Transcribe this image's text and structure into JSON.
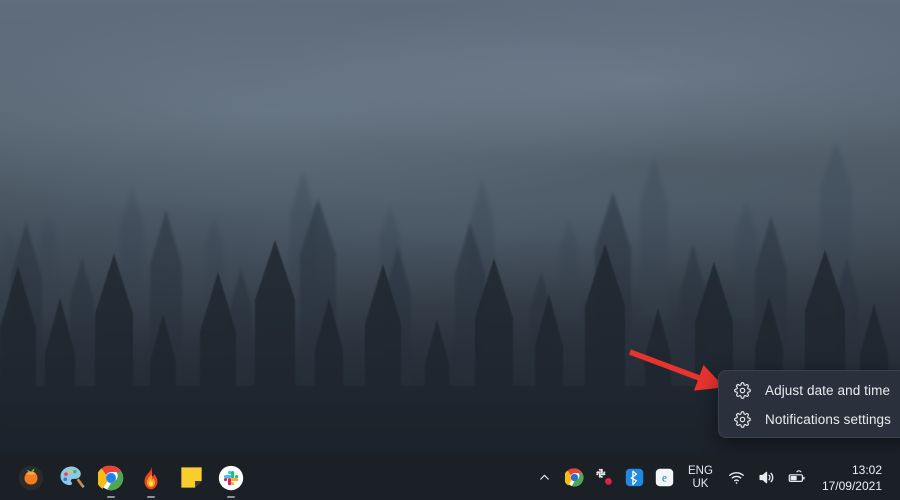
{
  "desktop": {
    "wallpaper_description": "misty-forest-conifers",
    "colors": {
      "sky": "#5f6d7d",
      "fog": "#8c9eb2",
      "tree_dark": "#232a33",
      "taskbar": "#1b2027",
      "menu_background": "#2a313c",
      "menu_text": "#e9ecef",
      "annotation_arrow": "#e8332f"
    }
  },
  "annotation": {
    "type": "arrow",
    "color": "#e8332f",
    "points_to": "adjust-date-and-time-menu-item"
  },
  "context_menu": {
    "items": [
      {
        "label": "Adjust date and time",
        "icon": "gear-icon"
      },
      {
        "label": "Notifications settings",
        "icon": "gear-icon"
      }
    ]
  },
  "taskbar": {
    "apps": [
      {
        "name": "fl-studio",
        "label": "FL Studio",
        "running": false
      },
      {
        "name": "paint",
        "label": "Paint",
        "running": false
      },
      {
        "name": "chrome",
        "label": "Google Chrome",
        "running": true
      },
      {
        "name": "flame-app",
        "label": "Flame",
        "running": true
      },
      {
        "name": "sticky-notes",
        "label": "Sticky Notes",
        "running": false
      },
      {
        "name": "slack",
        "label": "Slack",
        "running": true
      }
    ],
    "tray": {
      "show_hidden_icons": "chevron-up-icon",
      "icons": [
        {
          "name": "chrome-tray-icon",
          "label": "Google Chrome"
        },
        {
          "name": "slack-tray-icon",
          "label": "Slack"
        },
        {
          "name": "bluetooth-icon",
          "label": "Bluetooth"
        },
        {
          "name": "edge-icon",
          "label": "Microsoft Edge"
        }
      ],
      "language": {
        "line1": "ENG",
        "line2": "UK"
      },
      "status_icons": [
        {
          "name": "wifi-icon",
          "label": "Network"
        },
        {
          "name": "volume-icon",
          "label": "Volume"
        },
        {
          "name": "battery-icon",
          "label": "Battery"
        }
      ],
      "clock": {
        "time": "13:02",
        "date": "17/09/2021"
      }
    }
  }
}
